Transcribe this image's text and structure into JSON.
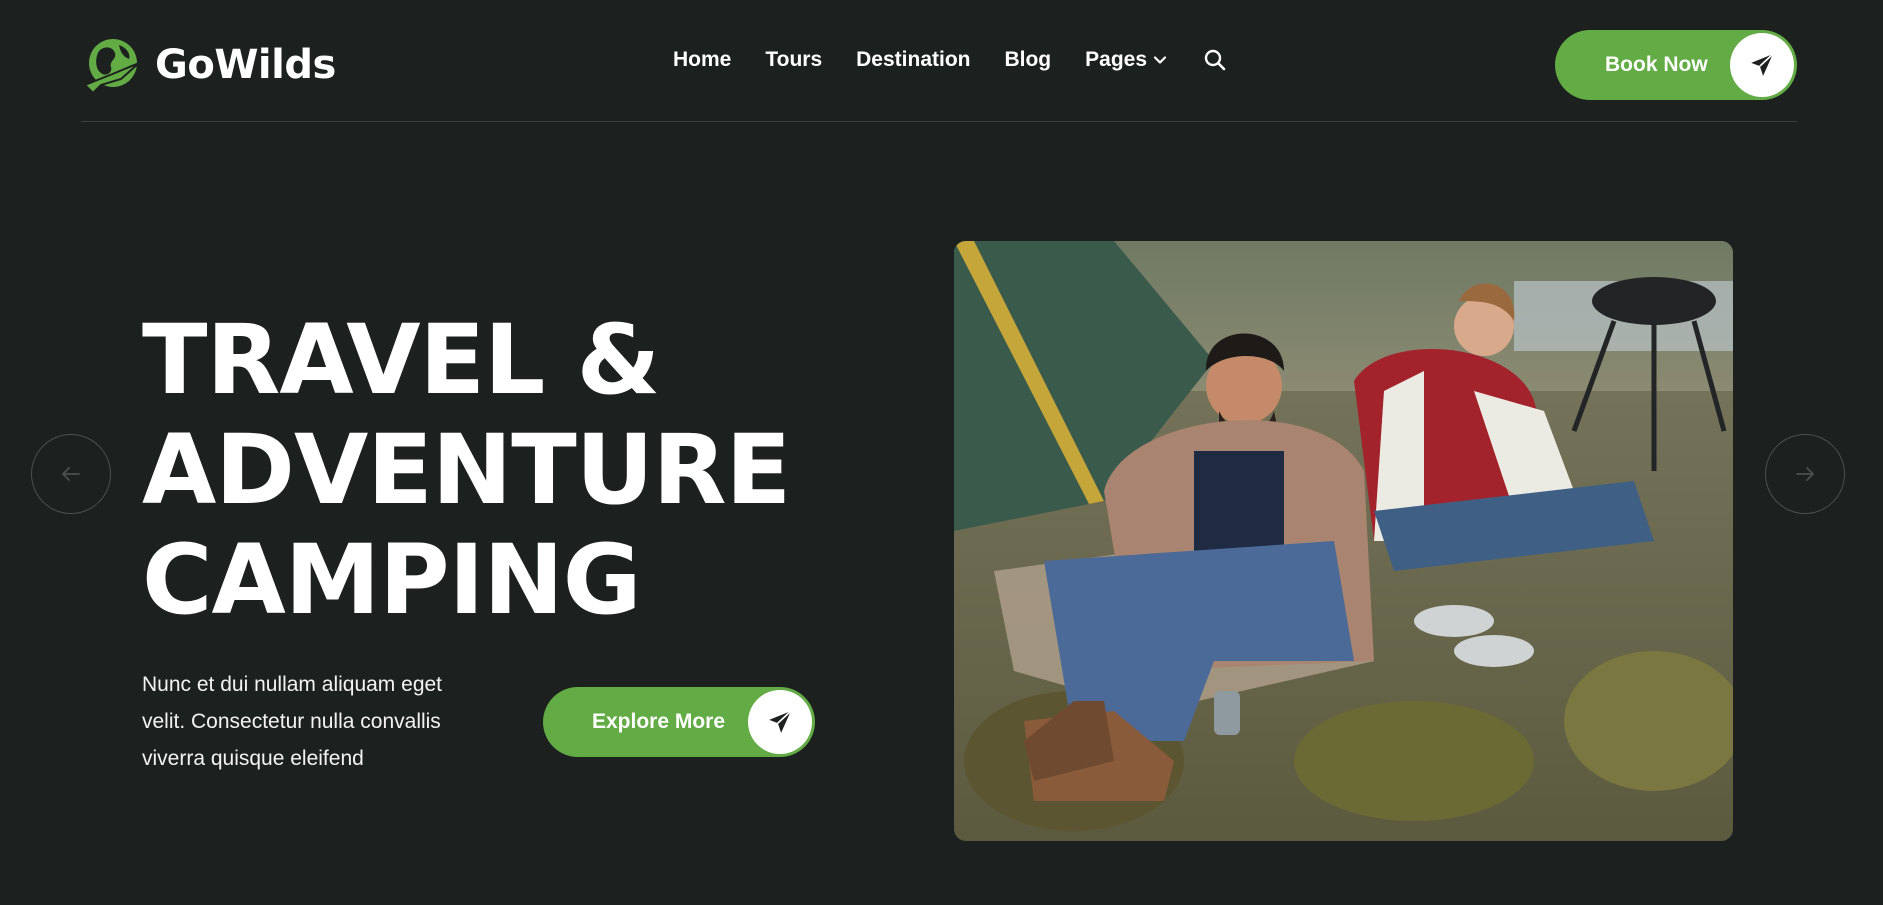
{
  "brand": {
    "name": "GoWilds",
    "accent": "#63ab45",
    "background": "#1c211f"
  },
  "nav": {
    "items": [
      {
        "label": "Home"
      },
      {
        "label": "Tours"
      },
      {
        "label": "Destination"
      },
      {
        "label": "Blog"
      },
      {
        "label": "Pages",
        "icon": "chevron-down-icon"
      }
    ],
    "search_icon": "search-icon"
  },
  "header": {
    "cta_label": "Book Now",
    "cta_icon": "paper-plane-icon"
  },
  "hero": {
    "title_lines": [
      "TRAVEL &",
      "ADVENTURE",
      "CAMPING"
    ],
    "description": "Nunc et dui nullam aliquam eget velit. Consectetur nulla convallis viverra quisque eleifend",
    "cta_label": "Explore More",
    "cta_icon": "paper-plane-icon",
    "image_alt": "Couple camping outdoors next to a tent and grill"
  },
  "slider": {
    "prev_icon": "arrow-left-icon",
    "next_icon": "arrow-right-icon"
  }
}
